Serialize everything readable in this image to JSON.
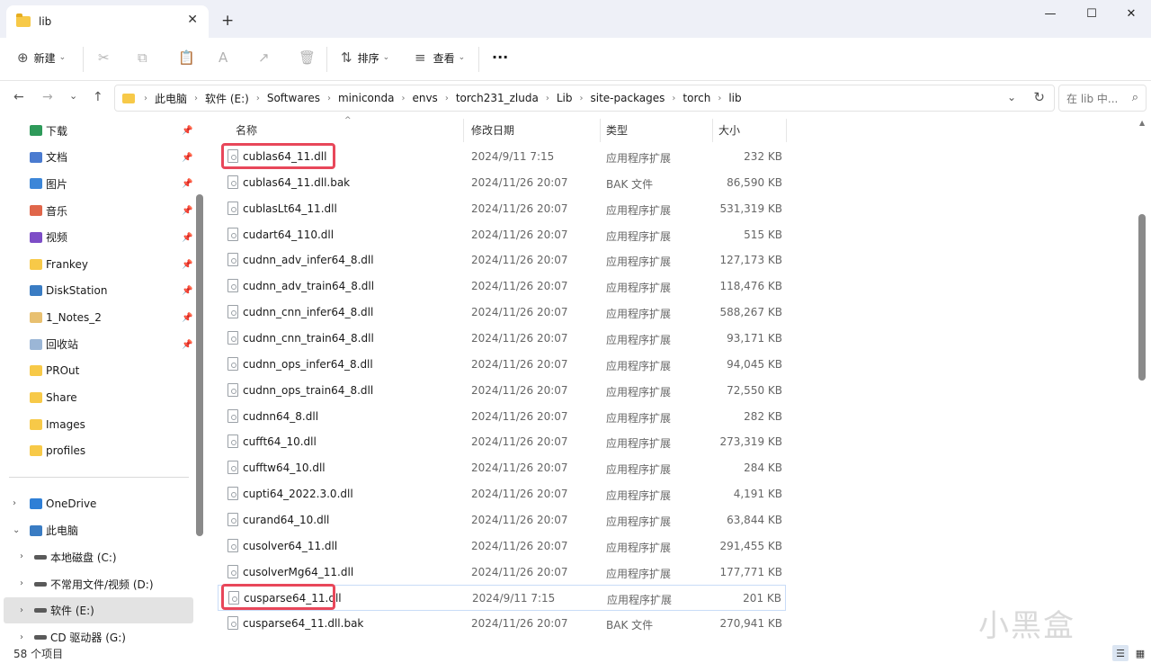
{
  "window": {
    "tab_title": "lib",
    "close_tab": "✕",
    "new_tab": "+",
    "minimize": "—",
    "maximize": "☐",
    "close": "✕"
  },
  "toolbar": {
    "new_label": "新建",
    "new_icon": "⊕",
    "sort_label": "排序",
    "sort_icon": "⇅",
    "view_label": "查看",
    "view_icon": "≡",
    "more_icon": "···",
    "dropdown_icon": "⌄",
    "cut_icon": "✂",
    "copy_icon": "⧉",
    "paste_icon": "📋",
    "rename_icon": "A",
    "share_icon": "↗",
    "delete_icon": "🗑"
  },
  "nav": {
    "back": "←",
    "forward": "→",
    "recent": "⌄",
    "up": "↑",
    "addr_dropdown": "⌄",
    "refresh": "↻"
  },
  "breadcrumb": [
    "此电脑",
    "软件 (E:)",
    "Softwares",
    "miniconda",
    "envs",
    "torch231_zluda",
    "Lib",
    "site-packages",
    "torch",
    "lib"
  ],
  "search": {
    "placeholder": "在 lib 中...",
    "icon": "⌕"
  },
  "sidebar": {
    "quick_access": [
      {
        "label": "下载",
        "color": "#2e9a5a",
        "pinned": true
      },
      {
        "label": "文档",
        "color": "#4a7bd0",
        "pinned": true
      },
      {
        "label": "图片",
        "color": "#3c86d8",
        "pinned": true
      },
      {
        "label": "音乐",
        "color": "#e0664a",
        "pinned": true
      },
      {
        "label": "视频",
        "color": "#7d4dc7",
        "pinned": true
      },
      {
        "label": "Frankey",
        "color": "#f7c948",
        "pinned": true
      },
      {
        "label": "DiskStation",
        "color": "#3a7cc3",
        "pinned": true
      },
      {
        "label": "1_Notes_2",
        "color": "#e8c070",
        "pinned": true
      },
      {
        "label": "回收站",
        "color": "#9bb6d6",
        "pinned": true
      },
      {
        "label": "PROut",
        "color": "#f7c948",
        "pinned": false
      },
      {
        "label": "Share",
        "color": "#f7c948",
        "pinned": false
      },
      {
        "label": "Images",
        "color": "#f7c948",
        "pinned": false
      },
      {
        "label": "profiles",
        "color": "#f7c948",
        "pinned": false
      }
    ],
    "pin_icon": "📌",
    "tree": [
      {
        "label": "OneDrive",
        "expand": "›",
        "color": "#2f7fd6"
      },
      {
        "label": "此电脑",
        "expand": "⌄",
        "color": "#3a7cc3"
      },
      {
        "label": "本地磁盘 (C:)",
        "expand": "›",
        "color": "#5a5a5a"
      },
      {
        "label": "不常用文件/视频 (D:)",
        "expand": "›",
        "color": "#5a5a5a"
      },
      {
        "label": "软件 (E:)",
        "expand": "›",
        "color": "#5a5a5a"
      },
      {
        "label": "CD 驱动器 (G:)",
        "expand": "›",
        "color": "#5a5a5a"
      }
    ]
  },
  "columns": {
    "name": "名称",
    "date": "修改日期",
    "type": "类型",
    "size": "大小",
    "sort_indicator": "^"
  },
  "files": [
    {
      "name": "cublas64_11.dll",
      "date": "2024/9/11 7:15",
      "type": "应用程序扩展",
      "size": "232 KB"
    },
    {
      "name": "cublas64_11.dll.bak",
      "date": "2024/11/26 20:07",
      "type": "BAK 文件",
      "size": "86,590 KB"
    },
    {
      "name": "cublasLt64_11.dll",
      "date": "2024/11/26 20:07",
      "type": "应用程序扩展",
      "size": "531,319 KB"
    },
    {
      "name": "cudart64_110.dll",
      "date": "2024/11/26 20:07",
      "type": "应用程序扩展",
      "size": "515 KB"
    },
    {
      "name": "cudnn_adv_infer64_8.dll",
      "date": "2024/11/26 20:07",
      "type": "应用程序扩展",
      "size": "127,173 KB"
    },
    {
      "name": "cudnn_adv_train64_8.dll",
      "date": "2024/11/26 20:07",
      "type": "应用程序扩展",
      "size": "118,476 KB"
    },
    {
      "name": "cudnn_cnn_infer64_8.dll",
      "date": "2024/11/26 20:07",
      "type": "应用程序扩展",
      "size": "588,267 KB"
    },
    {
      "name": "cudnn_cnn_train64_8.dll",
      "date": "2024/11/26 20:07",
      "type": "应用程序扩展",
      "size": "93,171 KB"
    },
    {
      "name": "cudnn_ops_infer64_8.dll",
      "date": "2024/11/26 20:07",
      "type": "应用程序扩展",
      "size": "94,045 KB"
    },
    {
      "name": "cudnn_ops_train64_8.dll",
      "date": "2024/11/26 20:07",
      "type": "应用程序扩展",
      "size": "72,550 KB"
    },
    {
      "name": "cudnn64_8.dll",
      "date": "2024/11/26 20:07",
      "type": "应用程序扩展",
      "size": "282 KB"
    },
    {
      "name": "cufft64_10.dll",
      "date": "2024/11/26 20:07",
      "type": "应用程序扩展",
      "size": "273,319 KB"
    },
    {
      "name": "cufftw64_10.dll",
      "date": "2024/11/26 20:07",
      "type": "应用程序扩展",
      "size": "284 KB"
    },
    {
      "name": "cupti64_2022.3.0.dll",
      "date": "2024/11/26 20:07",
      "type": "应用程序扩展",
      "size": "4,191 KB"
    },
    {
      "name": "curand64_10.dll",
      "date": "2024/11/26 20:07",
      "type": "应用程序扩展",
      "size": "63,844 KB"
    },
    {
      "name": "cusolver64_11.dll",
      "date": "2024/11/26 20:07",
      "type": "应用程序扩展",
      "size": "291,455 KB"
    },
    {
      "name": "cusolverMg64_11.dll",
      "date": "2024/11/26 20:07",
      "type": "应用程序扩展",
      "size": "177,771 KB"
    },
    {
      "name": "cusparse64_11.dll",
      "date": "2024/9/11 7:15",
      "type": "应用程序扩展",
      "size": "201 KB"
    },
    {
      "name": "cusparse64_11.dll.bak",
      "date": "2024/11/26 20:07",
      "type": "BAK 文件",
      "size": "270,941 KB"
    }
  ],
  "highlight_color": "#e8475a",
  "status": {
    "item_count": "58 个项目"
  },
  "view_icons": {
    "details": "☰",
    "tiles": "▦"
  },
  "watermark": "小黑盒"
}
